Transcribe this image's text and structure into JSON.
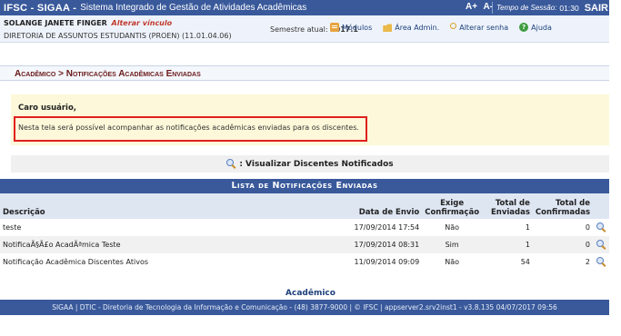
{
  "header": {
    "brand": "IFSC - SIGAA -",
    "subtitle": "Sistema Integrado de Gestão de Atividades Acadêmicas",
    "font_increase": "A+",
    "font_decrease": "A-",
    "session_label": "Tempo de Sessão:",
    "session_time": "01:30",
    "logout": "SAIR"
  },
  "user": {
    "name": "SOLANGE JANETE FINGER",
    "change_link": "Alterar vínculo",
    "department": "DIRETORIA DE ASSUNTOS ESTUDANTIS (PROEN) (11.01.04.06)",
    "semester_label": "Semestre atual:",
    "semester_value": "2017.1"
  },
  "toolbar": {
    "modulos": "Módulos",
    "area_admin": "Área Admin.",
    "alterar_senha": "Alterar senha",
    "ajuda": "Ajuda"
  },
  "breadcrumb": "Acadêmico > Notificações Acadêmicas Enviadas",
  "notice": {
    "title": "Caro usuário,",
    "text": "Nesta tela será possível acompanhar as notificações acadêmicas enviadas para os discentes."
  },
  "legend": {
    "text": ": Visualizar Discentes Notificados"
  },
  "list": {
    "title": "Lista de Notificações Enviadas",
    "headers": {
      "descricao": "Descrição",
      "data": "Data de Envio",
      "exige": "Exige Confirmação",
      "total_enviadas": "Total de Enviadas",
      "total_confirmadas": "Total de Confirmadas"
    },
    "rows": [
      {
        "descricao": "teste",
        "data": "17/09/2014 17:54",
        "exige": "Não",
        "enviadas": "1",
        "confirmadas": "0"
      },
      {
        "descricao": "NotificaÃ§Ã£o AcadÃªmica Teste",
        "data": "17/09/2014 08:31",
        "exige": "Sim",
        "enviadas": "1",
        "confirmadas": "0"
      },
      {
        "descricao": "Notificação Acadêmica Discentes Ativos",
        "data": "11/09/2014 09:09",
        "exige": "Não",
        "enviadas": "54",
        "confirmadas": "2"
      }
    ]
  },
  "module_link": "Acadêmico",
  "footer": "SIGAA | DTIC - Diretoria de Tecnologia da Informação e Comunicação - (48) 3877-9000 | © IFSC | appserver2.srv2inst1 - v3.8.135 04/07/2017 09:56",
  "icons": {
    "view": "magnifier-icon",
    "modulos": "modules-icon",
    "admin": "folder-icon",
    "senha": "key-icon",
    "ajuda": "help-icon"
  }
}
